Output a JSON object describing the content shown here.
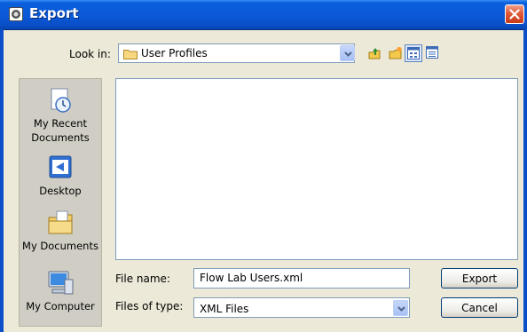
{
  "window": {
    "title": "Export"
  },
  "toolbar": {
    "lookin_label": "Look in:",
    "lookin_value": "User Profiles",
    "icons": [
      "up-one-level-icon",
      "new-folder-icon",
      "view-menu-icon",
      "details-view-icon"
    ]
  },
  "places": [
    {
      "label": "My Recent Documents",
      "icon": "recent-documents-icon"
    },
    {
      "label": "Desktop",
      "icon": "desktop-icon"
    },
    {
      "label": "My Documents",
      "icon": "my-documents-icon"
    },
    {
      "label": "My Computer",
      "icon": "my-computer-icon"
    }
  ],
  "form": {
    "filename_label": "File name:",
    "filename_value": "Flow Lab Users.xml",
    "filetype_label": "Files of type:",
    "filetype_value": "XML Files"
  },
  "buttons": {
    "export": "Export",
    "cancel": "Cancel"
  },
  "colors": {
    "titlebar": "#0b58d6",
    "close": "#e05a38",
    "dialog": "#ece9d8"
  }
}
